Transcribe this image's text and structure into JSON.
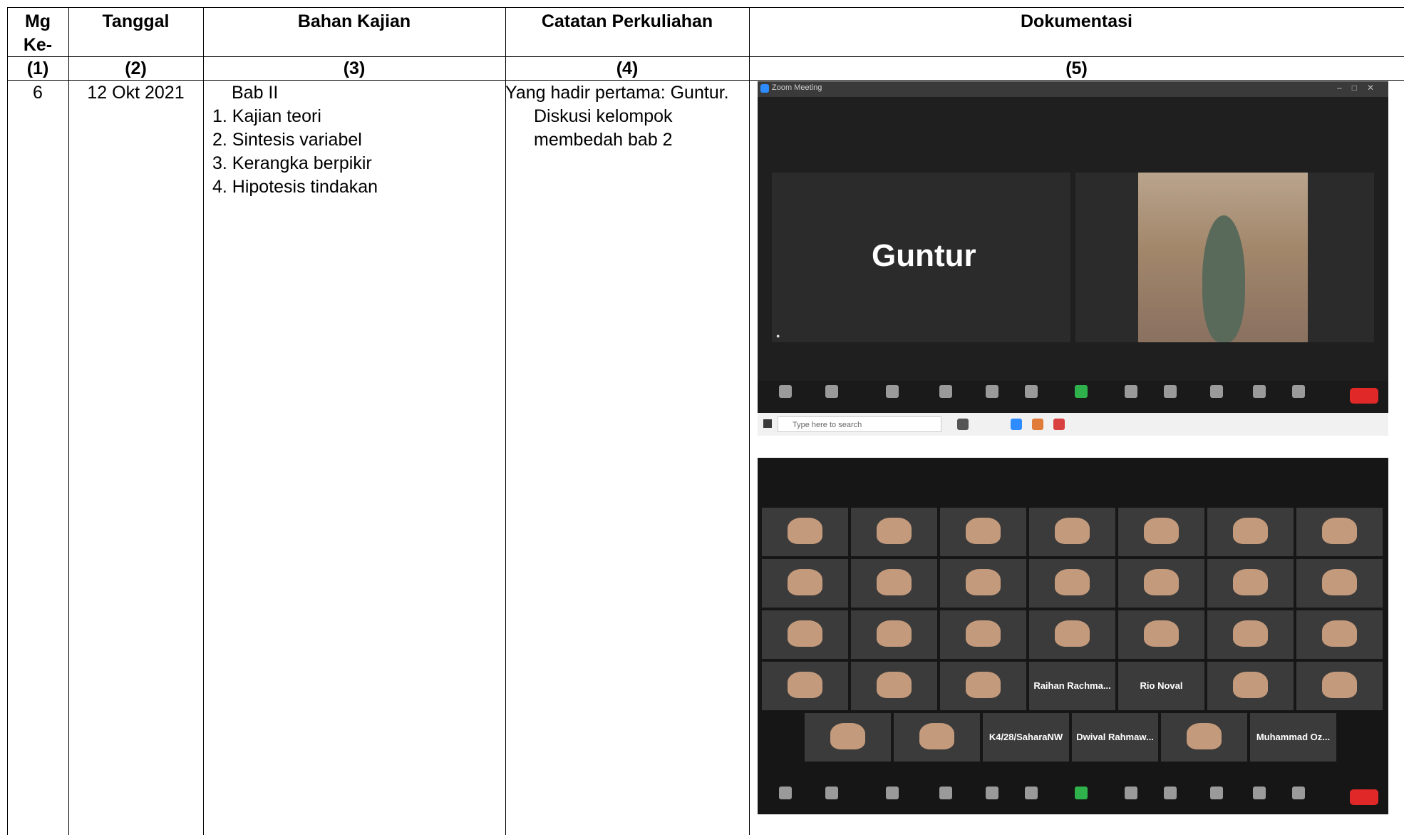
{
  "headers": {
    "col1": "Mg Ke-",
    "col1_line1": "Mg",
    "col1_line2": "Ke-",
    "col2": "Tanggal",
    "col3": "Bahan Kajian",
    "col4": "Catatan Perkuliahan",
    "col5": "Dokumentasi"
  },
  "column_numbers": [
    "(1)",
    "(2)",
    "(3)",
    "(4)",
    "(5)"
  ],
  "row": {
    "week": "6",
    "date": "12 Okt 2021",
    "topic_title": "Bab II",
    "topics": [
      "1. Kajian teori",
      "2. Sintesis variabel",
      "3. Kerangka berpikir",
      "4. Hipotesis tindakan"
    ],
    "notes": [
      "Yang hadir pertama: Guntur.",
      "Diskusi kelompok",
      "membedah bab 2"
    ]
  },
  "screenshot1": {
    "window_title": "Zoom Meeting",
    "speaker_name": "Guntur",
    "taskbar_search_placeholder": "Type here to search"
  },
  "screenshot2": {
    "name_tiles": [
      "Raihan  Rachma...",
      "Rio Noval",
      "K4/28/SaharaNW",
      "Dwival  Rahmaw...",
      "Muhammad  Oz..."
    ]
  },
  "colors": {
    "zoom_bg": "#1f1f1f",
    "end_button": "#e02828",
    "share_green": "#2fb14c",
    "zoom_blue": "#2d8cff"
  }
}
